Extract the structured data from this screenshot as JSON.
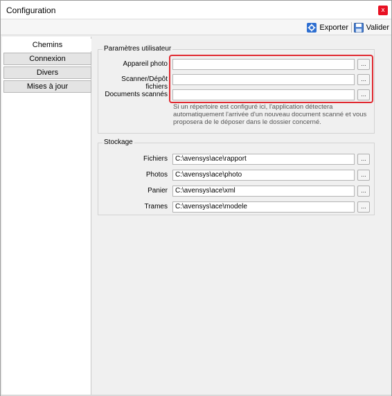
{
  "window": {
    "title": "Configuration",
    "close_label": "x"
  },
  "toolbar": {
    "export_label": "Exporter",
    "valider_label": "Valider"
  },
  "sidebar": {
    "items": [
      {
        "label": "Chemins",
        "active": true
      },
      {
        "label": "Connexion",
        "active": false
      },
      {
        "label": "Divers",
        "active": false
      },
      {
        "label": "Mises à jour",
        "active": false
      }
    ]
  },
  "user_params": {
    "title": "Paramètres utilisateur",
    "rows": [
      {
        "label": "Appareil photo",
        "value": ""
      },
      {
        "label": "Scanner/Dépôt fichiers",
        "value": ""
      },
      {
        "label": "Documents scannés",
        "value": ""
      }
    ],
    "hint": "Si un répertoire est configuré ici, l'application détectera automatiquement l'arrivée d'un nouveau document scanné et vous proposera de le déposer dans le dossier concerné."
  },
  "storage": {
    "title": "Stockage",
    "rows": [
      {
        "label": "Fichiers",
        "value": "C:\\avensys\\ace\\rapport"
      },
      {
        "label": "Photos",
        "value": "C:\\avensys\\ace\\photo"
      },
      {
        "label": "Panier",
        "value": "C:\\avensys\\ace\\xml"
      },
      {
        "label": "Trames",
        "value": "C:\\avensys\\ace\\modele"
      }
    ]
  },
  "browse_label": "...",
  "colors": {
    "highlight": "#e0282f",
    "close": "#e81123",
    "export_icon": "#2e6fd1"
  }
}
